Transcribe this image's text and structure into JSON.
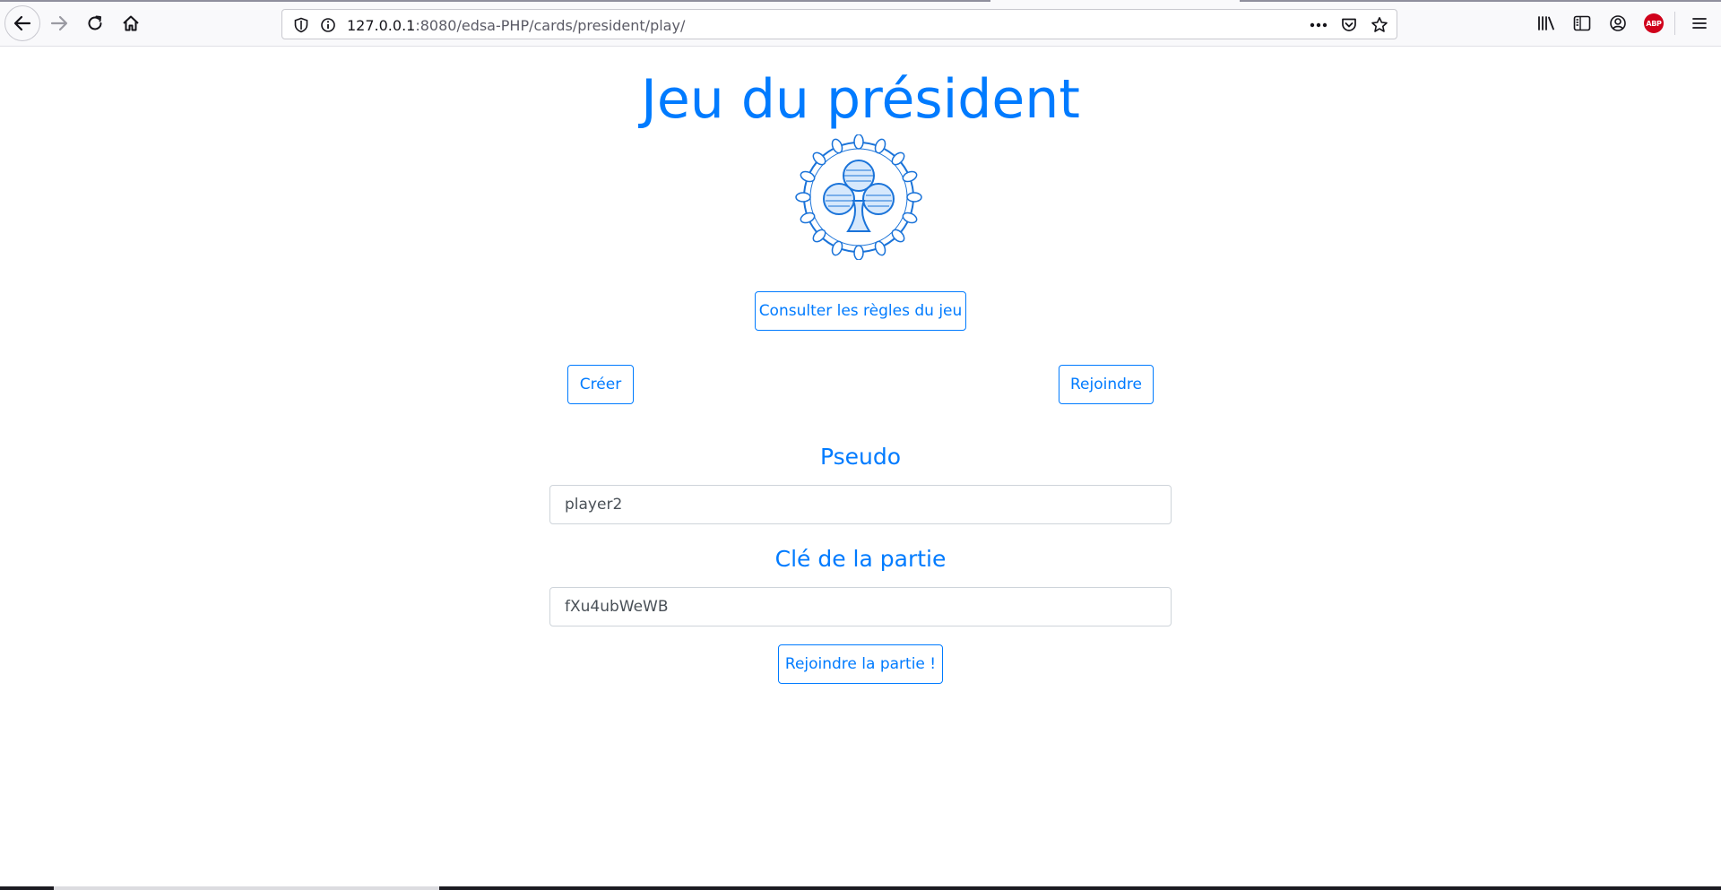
{
  "browser": {
    "url_host": "127.0.0.1",
    "url_rest": ":8080/edsa-PHP/cards/president/play/",
    "icons": [
      "back-icon",
      "forward-icon",
      "reload-icon",
      "home-icon",
      "shield-icon",
      "info-icon",
      "more-icon",
      "pocket-icon",
      "star-icon",
      "library-icon",
      "sidebar-icon",
      "account-icon",
      "adblock-icon",
      "menu-icon"
    ],
    "adblock_label": "ABP"
  },
  "page": {
    "title": "Jeu du président",
    "logo_icon": "club-wreath-icon",
    "rules_button": "Consulter les règles du jeu",
    "create_button": "Créer",
    "join_button": "Rejoindre",
    "pseudo_label": "Pseudo",
    "pseudo_value": "player2",
    "key_label": "Clé de la partie",
    "key_value": "fXu4ubWeWB",
    "submit_button": "Rejoindre la partie !"
  },
  "colors": {
    "accent": "#007bff",
    "input_text": "#495057",
    "input_border": "#ced4da"
  }
}
